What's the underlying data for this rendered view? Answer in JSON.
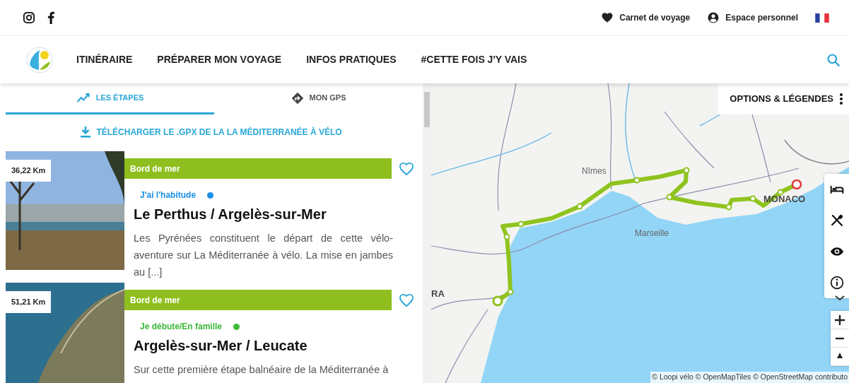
{
  "topbar": {
    "links": [
      {
        "label": "Carnet de voyage"
      },
      {
        "label": "Espace personnel"
      }
    ]
  },
  "nav": {
    "items": [
      {
        "label": "ITINÉRAIRE"
      },
      {
        "label": "PRÉPARER MON VOYAGE"
      },
      {
        "label": "INFOS PRATIQUES"
      },
      {
        "label": "#CETTE FOIS J'Y VAIS"
      }
    ]
  },
  "panel": {
    "tabs": [
      {
        "label": "LES ÉTAPES",
        "selected": true
      },
      {
        "label": "MON GPS",
        "selected": false
      }
    ],
    "download": "TÉLÉCHARGER LE .GPX DE LA LA MÉDITERRANÉE À VÉLO",
    "stages": [
      {
        "distance": "36,22 Km",
        "tag": "Bord de mer",
        "level": "J'ai l'habitude",
        "color": "#1a8fe6",
        "title": "Le Perthus / Argelès-sur-Mer",
        "description": "Les Pyrénées constituent le départ de cette vélo-aventure sur La Méditerranée à vélo. La mise en jambes au [...]",
        "favorite": false
      },
      {
        "distance": "51,21 Km",
        "tag": "Bord de mer",
        "level": "Je débute/En famille",
        "color": "#3db83a",
        "title": "Argelès-sur-Mer / Leucate",
        "description": "Sur cette première étape balnéaire de la Méditerranée à",
        "favorite": false
      }
    ]
  },
  "map": {
    "options": "OPTIONS & LÉGENDES",
    "labels": [
      {
        "text": "Nîmes",
        "kind": "city"
      },
      {
        "text": "Marseille",
        "kind": "city"
      },
      {
        "text": "MONACO",
        "kind": "country"
      },
      {
        "text": "RA",
        "kind": "country"
      }
    ],
    "attribution": "© Loopi vélo © OpenMapTiles © OpenStreetMap contributo"
  }
}
